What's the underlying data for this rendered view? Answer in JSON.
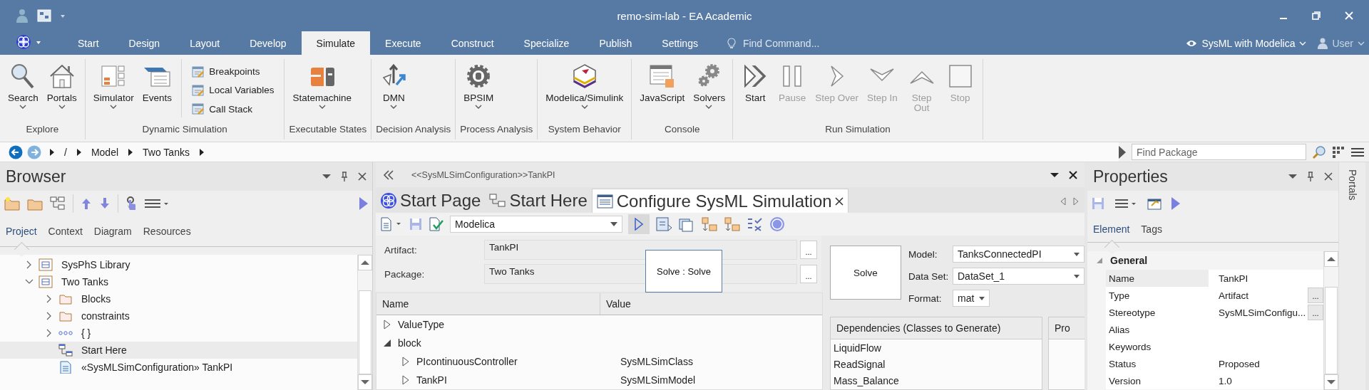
{
  "window": {
    "title": "remo-sim-lab - EA Academic"
  },
  "ribbon_tabs": [
    {
      "label": "Start",
      "selected": false
    },
    {
      "label": "Design",
      "selected": false
    },
    {
      "label": "Layout",
      "selected": false
    },
    {
      "label": "Develop",
      "selected": false
    },
    {
      "label": "Simulate",
      "selected": true
    },
    {
      "label": "Execute",
      "selected": false
    },
    {
      "label": "Construct",
      "selected": false
    },
    {
      "label": "Specialize",
      "selected": false
    },
    {
      "label": "Publish",
      "selected": false
    },
    {
      "label": "Settings",
      "selected": false
    }
  ],
  "find_command": {
    "placeholder": "Find Command..."
  },
  "perspective": {
    "label": "SysML with Modelica"
  },
  "user": {
    "label": "User"
  },
  "ribbon_groups": [
    {
      "label": "Explore",
      "items": [
        {
          "kind": "large",
          "label": "Search",
          "dropdown": true
        },
        {
          "kind": "large",
          "label": "Portals",
          "dropdown": true
        }
      ]
    },
    {
      "label": "Dynamic Simulation",
      "items": [
        {
          "kind": "large",
          "label": "Simulator",
          "dropdown": true
        },
        {
          "kind": "large",
          "label": "Events",
          "dropdown": false
        },
        {
          "kind": "small",
          "label": "Breakpoints"
        },
        {
          "kind": "small",
          "label": "Local Variables"
        },
        {
          "kind": "small",
          "label": "Call Stack"
        }
      ]
    },
    {
      "label": "Executable States",
      "items": [
        {
          "kind": "large",
          "label": "Statemachine",
          "dropdown": true
        }
      ]
    },
    {
      "label": "Decision Analysis",
      "items": [
        {
          "kind": "large",
          "label": "DMN",
          "dropdown": true
        }
      ]
    },
    {
      "label": "Process Analysis",
      "items": [
        {
          "kind": "large",
          "label": "BPSIM",
          "dropdown": true
        }
      ]
    },
    {
      "label": "System Behavior",
      "items": [
        {
          "kind": "large",
          "label": "Modelica/Simulink",
          "dropdown": true
        }
      ]
    },
    {
      "label": "Console",
      "items": [
        {
          "kind": "large",
          "label": "JavaScript",
          "dropdown": false
        },
        {
          "kind": "large",
          "label": "Solvers",
          "dropdown": true
        }
      ]
    },
    {
      "label": "Run Simulation",
      "items": [
        {
          "kind": "large",
          "label": "Start",
          "disabled": false
        },
        {
          "kind": "large",
          "label": "Pause",
          "disabled": true
        },
        {
          "kind": "large",
          "label": "Step Over",
          "disabled": true
        },
        {
          "kind": "large",
          "label": "Step In",
          "disabled": true
        },
        {
          "kind": "large",
          "label": "Step Out",
          "disabled": true
        },
        {
          "kind": "large",
          "label": "Stop",
          "disabled": true
        }
      ]
    }
  ],
  "breadcrumb": [
    "/",
    "Model",
    "Two Tanks"
  ],
  "find_package": {
    "placeholder": "Find Package"
  },
  "browser": {
    "title": "Browser",
    "tabs": [
      {
        "label": "Project",
        "selected": true
      },
      {
        "label": "Context",
        "selected": false
      },
      {
        "label": "Diagram",
        "selected": false
      },
      {
        "label": "Resources",
        "selected": false
      }
    ],
    "tree": [
      {
        "kind": "package",
        "label": "SysPhS Library",
        "expanded": false,
        "selected": false
      },
      {
        "kind": "package",
        "label": "Two Tanks",
        "expanded": true,
        "selected": false,
        "children": [
          {
            "kind": "folder",
            "label": "Blocks",
            "expanded": false,
            "selected": false
          },
          {
            "kind": "folder",
            "label": "constraints",
            "expanded": false,
            "selected": false
          },
          {
            "kind": "namespace",
            "label": "{ }",
            "expanded": false,
            "selected": false
          },
          {
            "kind": "diagram",
            "label": "Start Here",
            "selected": true
          },
          {
            "kind": "artifact",
            "label": "«SysMLSimConfiguration» TankPI",
            "selected": false
          }
        ]
      }
    ]
  },
  "editor": {
    "caption": "<<SysMLSimConfiguration>>TankPI",
    "tabs": [
      {
        "kind": "start",
        "label": "Start Page",
        "selected": false
      },
      {
        "kind": "diagram",
        "label": "Start Here",
        "selected": false
      },
      {
        "kind": "config",
        "label": "Configure SysML Simulation",
        "selected": true
      }
    ],
    "language": "Modelica",
    "fields": [
      {
        "label": "Artifact:",
        "value": "TankPI",
        "button": "..."
      },
      {
        "label": "Package:",
        "value": "Two Tanks",
        "button": "..."
      }
    ],
    "tooltip": "Solve : Solve",
    "table": {
      "columns": [
        "Name",
        "Value"
      ],
      "rows": [
        {
          "name": "ValueType",
          "expanded": false
        },
        {
          "name": "block",
          "expanded": true,
          "children": [
            {
              "name": "PIcontinuousController",
              "value": "SysMLSimClass",
              "expanded": false
            },
            {
              "name": "TankPI",
              "value": "SysMLSimModel",
              "expanded": false
            }
          ]
        }
      ]
    },
    "solve_button": "Solve",
    "settings": [
      {
        "label": "Model:",
        "value": "TanksConnectedPI"
      },
      {
        "label": "Data Set:",
        "value": "DataSet_1"
      },
      {
        "label": "Format:",
        "value": "mat"
      }
    ],
    "dependencies": {
      "title": "Dependencies (Classes to Generate)",
      "items": [
        "LiquidFlow",
        "ReadSignal",
        "Mass_Balance"
      ]
    },
    "side_panel": {
      "title": "Pro"
    }
  },
  "properties": {
    "title": "Properties",
    "tabs": [
      {
        "label": "Element",
        "selected": true
      },
      {
        "label": "Tags",
        "selected": false
      }
    ],
    "section": {
      "label": "General",
      "expanded": true
    },
    "rows": [
      {
        "name": "Name",
        "value": "TankPI",
        "selected": true
      },
      {
        "name": "Type",
        "value": "Artifact",
        "selected": false,
        "button": "..."
      },
      {
        "name": "Stereotype",
        "value": "SysMLSimConfigu...",
        "selected": false,
        "button": "..."
      },
      {
        "name": "Alias",
        "selected": false
      },
      {
        "name": "Keywords",
        "selected": false
      },
      {
        "name": "Status",
        "value": "Proposed",
        "selected": false
      },
      {
        "name": "Version",
        "value": "1.0",
        "selected": false
      }
    ]
  },
  "portals_tab": "Portals"
}
